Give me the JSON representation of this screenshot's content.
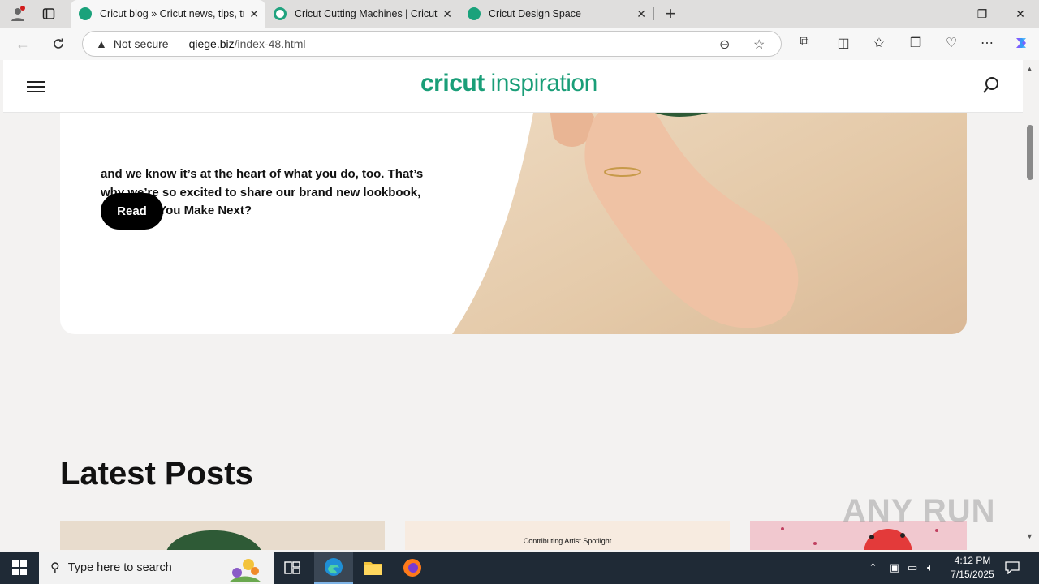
{
  "browser": {
    "tabs": [
      {
        "title": "Cricut blog » Cricut news, tips, tric",
        "active": true
      },
      {
        "title": "Cricut Cutting Machines | Cricut S",
        "active": false
      },
      {
        "title": "Cricut Design Space",
        "active": false
      }
    ],
    "security_label": "Not secure",
    "url_domain": "qiege.biz",
    "url_path": "/index-48.html"
  },
  "site": {
    "logo_bold": "cricut",
    "logo_light": "inspiration",
    "brand_color": "#1a9e78"
  },
  "hero": {
    "text": "and we know it’s at the heart of what you do, too. That’s why we’re so excited to share our brand new lookbook, What Will You Make Next?",
    "read_label": "Read"
  },
  "latest": {
    "heading": "Latest Posts",
    "cards": [
      {
        "label": ""
      },
      {
        "label": "Contributing Artist Spotlight"
      },
      {
        "label": ""
      }
    ]
  },
  "watermark": "ANY RUN",
  "taskbar": {
    "search_placeholder": "Type here to search",
    "time": "4:12 PM",
    "date": "7/15/2025"
  }
}
